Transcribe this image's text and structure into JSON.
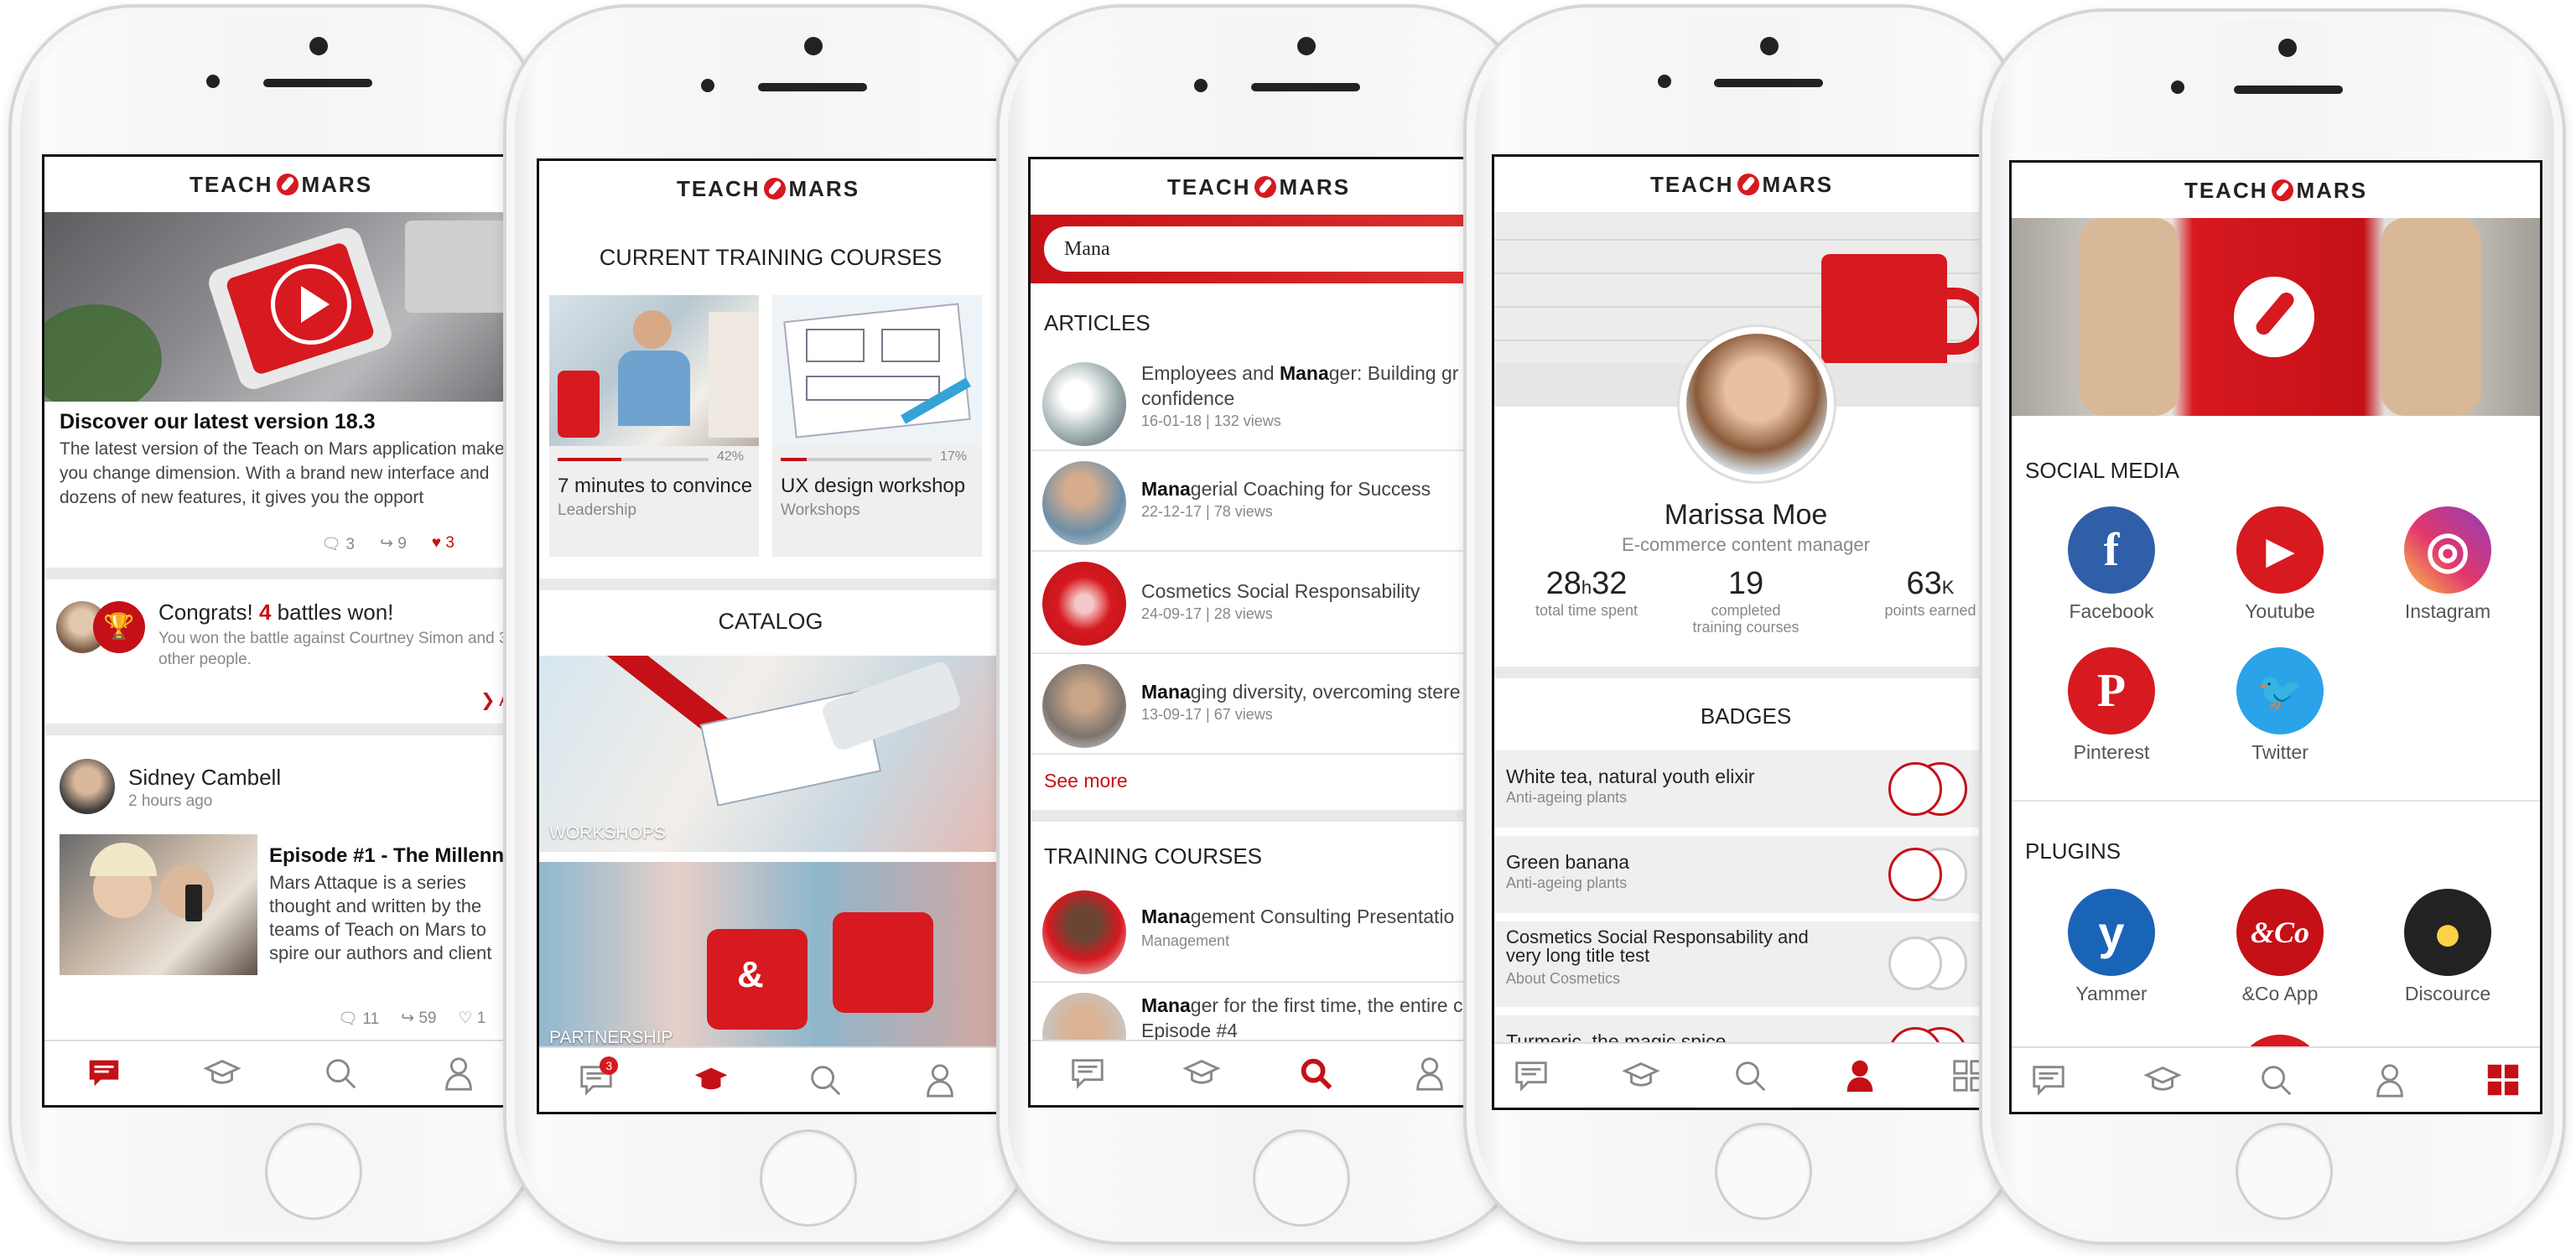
{
  "brand": {
    "left": "TEACH",
    "right": "MARS",
    "accent": "#d71920"
  },
  "feed": {
    "news_title": "Discover our latest version 18.3",
    "news_text": "The latest version of the Teach on Mars application make you change dimension. With a brand new interface and dozens of new features, it gives you the opport",
    "news_comments": "3",
    "news_shares": "9",
    "news_likes": "3",
    "battle_title_pre": "Congrats! ",
    "battle_count": "4",
    "battle_title_post": " battles won!",
    "battle_text": "You won the battle against Courtney Simon and 3 other people.",
    "battle_link": "Al",
    "author_name": "Sidney Cambell",
    "author_time": "2 hours ago",
    "post_title": "Episode #1 - The Millenn",
    "post_text": "Mars Attaque  is a series thought and written by the teams of Teach on Mars to spire our authors and client",
    "post_comments": "11",
    "post_shares": "59",
    "post_likes": "1"
  },
  "training": {
    "current_title": "CURRENT TRAINING COURSES",
    "courses": [
      {
        "title": "7 minutes to convince",
        "category": "Leadership",
        "progress": "42%",
        "progress_value": 0.42
      },
      {
        "title": "UX design workshop",
        "category": "Workshops",
        "progress": "17%",
        "progress_value": 0.17
      }
    ],
    "catalog_title": "CATALOG",
    "catalog_items": [
      "WORKSHOPS",
      "PARTNERSHIP"
    ],
    "notif_count": "3"
  },
  "search": {
    "query": "Mana",
    "articles_title": "ARTICLES",
    "articles": [
      {
        "pre": "Employees and ",
        "hl": "Mana",
        "post": "ger: Building gr",
        "line2": "confidence",
        "meta": "16-01-18  |  132 views"
      },
      {
        "pre": "",
        "hl": "Mana",
        "post": "gerial Coaching for Success",
        "line2": "",
        "meta": "22-12-17  |  78 views"
      },
      {
        "pre": "Cosmetics Social Responsability",
        "hl": "",
        "post": "",
        "line2": "",
        "meta": "24-09-17  |  28 views"
      },
      {
        "pre": "",
        "hl": "Mana",
        "post": "ging diversity, overcoming stere",
        "line2": "",
        "meta": "13-09-17  |  67 views"
      }
    ],
    "see_more": "See more",
    "training_title": "TRAINING COURSES",
    "courses": [
      {
        "hl": "Mana",
        "post": "gement Consulting Presentatio",
        "sub": "Management"
      },
      {
        "hl": "Mana",
        "post": "ger for the first time, the entire c",
        "sub": "Episode #4"
      }
    ]
  },
  "profile": {
    "name": "Marissa Moe",
    "role": "E-commerce content manager",
    "stats": [
      {
        "value": "28",
        "unit": "h",
        "value2": "32",
        "label": "total time spent"
      },
      {
        "value": "19",
        "unit": "",
        "value2": "",
        "label": "completed training courses"
      },
      {
        "value": "63",
        "unit": "K",
        "value2": "",
        "label": "points earned"
      }
    ],
    "badges_title": "BADGES",
    "badges": [
      {
        "title": "White tea, natural youth elixir",
        "sub": "Anti-ageing plants"
      },
      {
        "title": "Green banana",
        "sub": "Anti-ageing plants"
      },
      {
        "title": "Cosmetics Social Responsability and very long title test",
        "sub": "About Cosmetics"
      },
      {
        "title": "Turmeric, the magic spice",
        "sub": ""
      }
    ]
  },
  "apps": {
    "social_title": "SOCIAL MEDIA",
    "social": [
      {
        "label": "Facebook",
        "glyph": "f",
        "color": "#2f5fa8",
        "icon": "facebook-icon"
      },
      {
        "label": "Youtube",
        "glyph": "▶",
        "color": "#d71920",
        "icon": "youtube-icon"
      },
      {
        "label": "Instagram",
        "glyph": "◎",
        "color": "#c02a7b",
        "icon": "instagram-icon"
      },
      {
        "label": "Pinterest",
        "glyph": "P",
        "color": "#d71920",
        "icon": "pinterest-icon"
      },
      {
        "label": "Twitter",
        "glyph": "🐦",
        "color": "#2aa3e8",
        "icon": "twitter-icon"
      }
    ],
    "plugins_title": "PLUGINS",
    "plugins": [
      {
        "label": "Yammer",
        "glyph": "y",
        "color": "#1a64b8",
        "icon": "yammer-icon"
      },
      {
        "label": "&Co App",
        "glyph": "&Co",
        "color": "#c41016",
        "icon": "andco-icon"
      },
      {
        "label": "Discource",
        "glyph": "●",
        "color": "#222222",
        "icon": "discourse-icon"
      }
    ]
  }
}
